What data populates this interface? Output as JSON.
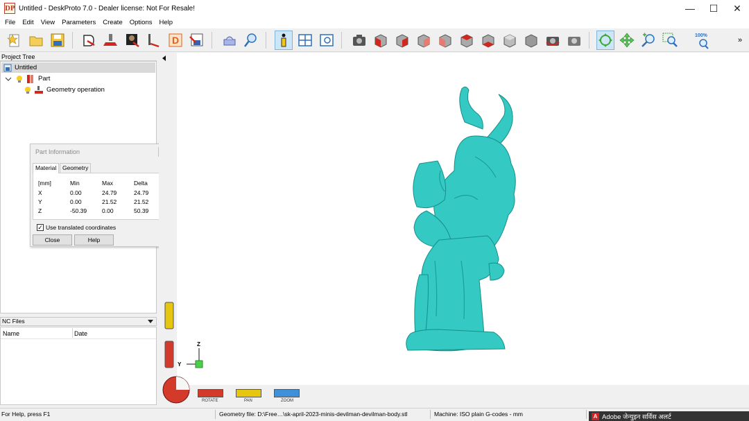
{
  "window": {
    "logo": "DP",
    "title": "Untitled - DeskProto 7.0 - Dealer license: Not For Resale!",
    "minimize": "—",
    "maximize": "☐",
    "close": "✕"
  },
  "menu": [
    "File",
    "Edit",
    "View",
    "Parameters",
    "Create",
    "Options",
    "Help"
  ],
  "toolbar": {
    "zoom_level": "100%",
    "overflow": "»",
    "icons": [
      "new-file-icon",
      "open-folder-icon",
      "save-icon",
      "import-part-icon",
      "import-operation-icon",
      "bitmap-icon",
      "vector-icon",
      "draw-icon",
      "export-icon",
      "render-icon",
      "inspect-icon",
      "part-info-icon",
      "window-icon",
      "preview-icon",
      "camera-icon",
      "cube-front-icon",
      "cube-right-icon",
      "cube-back-icon",
      "cube-left-icon",
      "cube-top-icon",
      "cube-bottom-icon",
      "cube-iso-icon",
      "cube-gray-icon",
      "camera-rotate-icon",
      "camera-lock-icon",
      "rotate-icon",
      "pan-icon",
      "zoom-icon",
      "zoom-window-icon",
      "zoom-100-icon"
    ]
  },
  "project_tree": {
    "header": "Project Tree",
    "root": "Untitled",
    "part": "Part",
    "operation": "Geometry operation"
  },
  "part_info": {
    "title": "Part Information",
    "tabs": [
      "Material",
      "Geometry"
    ],
    "columns": [
      "[mm]",
      "Min",
      "Max",
      "Delta"
    ],
    "rows": [
      [
        "X",
        "0.00",
        "24.79",
        "24.79"
      ],
      [
        "Y",
        "0.00",
        "21.52",
        "21.52"
      ],
      [
        "Z",
        "-50.39",
        "0.00",
        "50.39"
      ]
    ],
    "checkbox_label": "Use translated coordinates",
    "checkbox_checked": "✓",
    "close_label": "Close",
    "help_label": "Help"
  },
  "nc_files": {
    "header": "NC Files",
    "columns": [
      "Name",
      "Date"
    ]
  },
  "viewport": {
    "axis_z": "Z",
    "axis_y": "Y",
    "model_color": "#34c9c2",
    "controls": [
      "ROTATE",
      "PAN",
      "ZOOM"
    ]
  },
  "statusbar": {
    "help": "For Help, press F1",
    "geometry_file": "Geometry file: D:\\Free…\\sk-april-2023-minis-devilman-devilman-body.stl",
    "machine": "Machine: ISO plain G-codes - mm"
  },
  "notification": {
    "logo": "A",
    "text": "Adobe जेन्युइन सर्विस अलर्ट"
  }
}
